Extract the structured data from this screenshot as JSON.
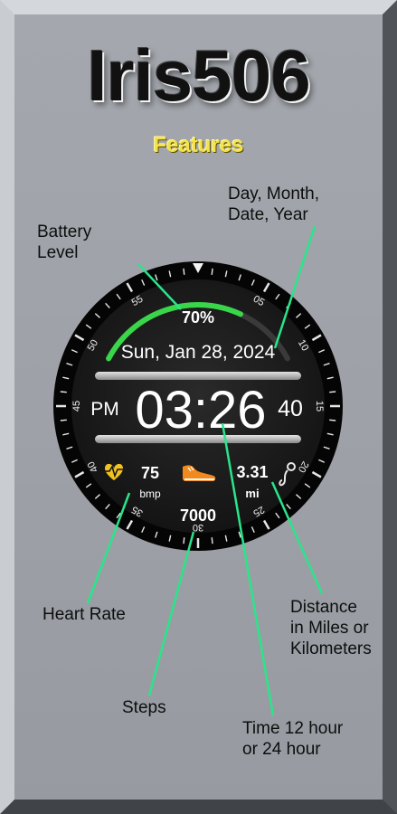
{
  "header": {
    "title": "Iris506",
    "subtitle": "Features"
  },
  "labels": {
    "battery": [
      "Battery",
      "Level"
    ],
    "date": [
      "Day, Month,",
      "Date, Year"
    ],
    "heart": [
      "Heart Rate"
    ],
    "distance": [
      "Distance",
      "in Miles or",
      "Kilometers"
    ],
    "steps": [
      "Steps"
    ],
    "time": [
      "Time 12 hour",
      "or 24 hour"
    ]
  },
  "watch": {
    "battery_percent": 70,
    "battery_text": "70%",
    "date_text": "Sun, Jan 28, 2024",
    "ampm": "PM",
    "time": "03:26",
    "seconds": "40",
    "heart_value": "75",
    "heart_unit": "bmp",
    "distance_value": "3.31",
    "distance_unit": "mi",
    "steps_value": "7000",
    "bezel_numbers": [
      "05",
      "10",
      "15",
      "20",
      "25",
      "30",
      "35",
      "40",
      "45",
      "50",
      "55"
    ]
  },
  "colors": {
    "leader_line": "#29e58a",
    "battery_arc": "#39d64a",
    "subtitle": "#f3e24a",
    "heart_icon": "#f2c222",
    "shoe_icon": "#f08a1d"
  },
  "icons": {
    "heart": "heart-icon",
    "shoe": "shoe-icon",
    "distance": "route-icon"
  }
}
